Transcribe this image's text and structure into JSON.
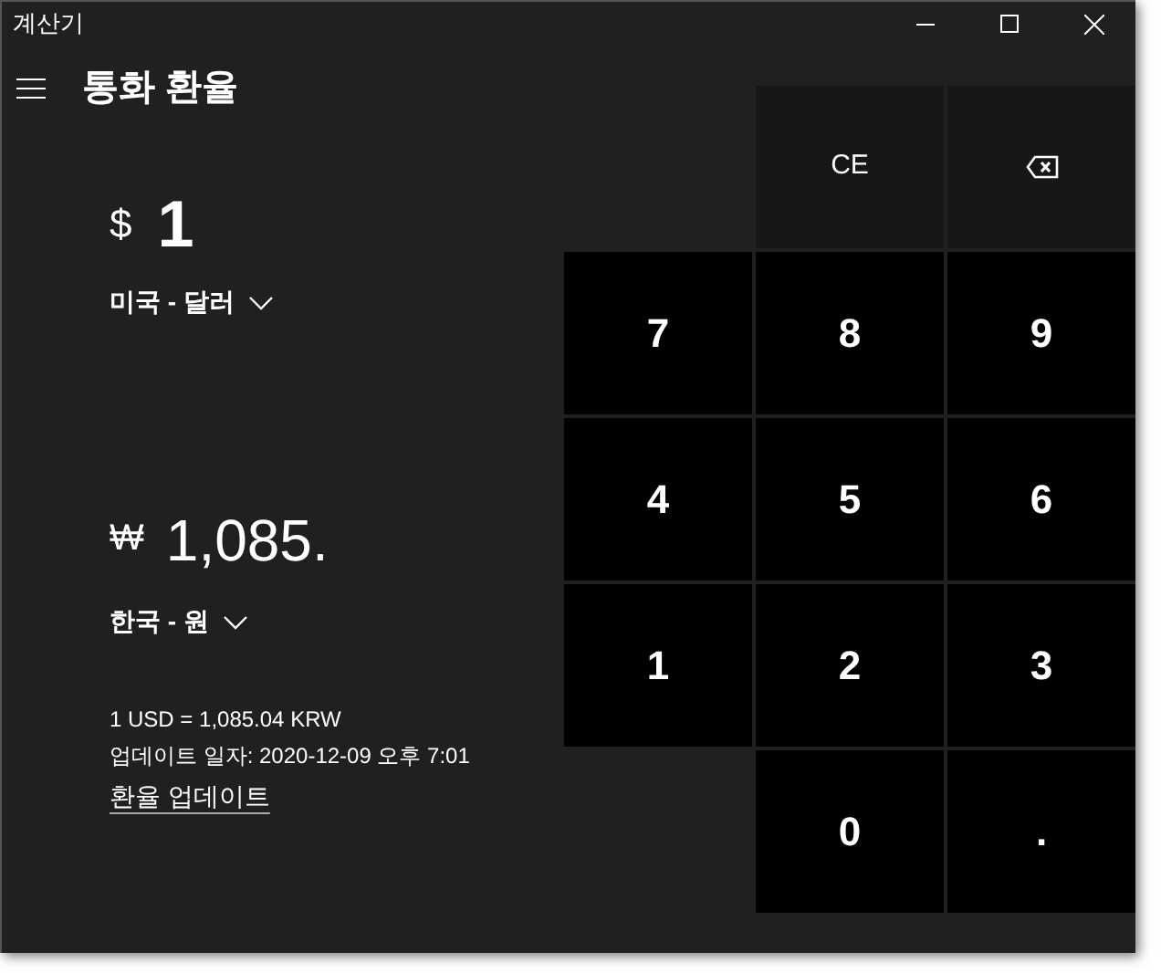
{
  "window": {
    "title": "계산기"
  },
  "header": {
    "title": "통화 환율"
  },
  "from": {
    "symbol": "$",
    "value": "1",
    "currency": "미국 - 달러"
  },
  "to": {
    "symbol": "₩",
    "value": "1,085.",
    "currency": "한국 - 원"
  },
  "rate": "1 USD = 1,085.04 KRW",
  "updated": "업데이트 일자: 2020-12-09 오후 7:01",
  "update_link": "환율 업데이트",
  "keypad": [
    [
      {
        "kind": "text",
        "label": "CE"
      },
      {
        "kind": "backspace"
      }
    ],
    [
      {
        "kind": "digit",
        "label": "7"
      },
      {
        "kind": "digit",
        "label": "8"
      },
      {
        "kind": "digit",
        "label": "9"
      }
    ],
    [
      {
        "kind": "digit",
        "label": "4"
      },
      {
        "kind": "digit",
        "label": "5"
      },
      {
        "kind": "digit",
        "label": "6"
      }
    ],
    [
      {
        "kind": "digit",
        "label": "1"
      },
      {
        "kind": "digit",
        "label": "2"
      },
      {
        "kind": "digit",
        "label": "3"
      }
    ],
    [
      {
        "kind": "digit",
        "label": "0"
      },
      {
        "kind": "digit",
        "label": "."
      }
    ]
  ]
}
